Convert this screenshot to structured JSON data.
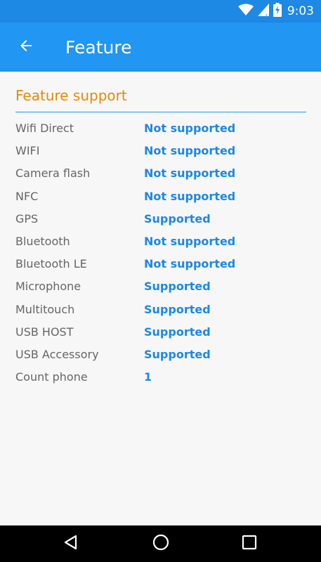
{
  "status_bar": {
    "time": "9:03",
    "icons": [
      "wifi-icon",
      "cellular-signal-icon",
      "battery-charging-icon"
    ]
  },
  "app_bar": {
    "title": "Feature",
    "back_icon": "arrow-back-icon"
  },
  "section": {
    "title": "Feature support"
  },
  "features": [
    {
      "label": "Wifi Direct",
      "value": "Not supported"
    },
    {
      "label": "WIFI",
      "value": "Not supported"
    },
    {
      "label": "Camera flash",
      "value": "Not supported"
    },
    {
      "label": "NFC",
      "value": "Not supported"
    },
    {
      "label": "GPS",
      "value": "Supported"
    },
    {
      "label": "Bluetooth",
      "value": "Not supported"
    },
    {
      "label": "Bluetooth LE",
      "value": "Not supported"
    },
    {
      "label": "Microphone",
      "value": "Supported"
    },
    {
      "label": "Multitouch",
      "value": "Supported"
    },
    {
      "label": "USB HOST",
      "value": "Supported"
    },
    {
      "label": "USB Accessory",
      "value": "Supported"
    },
    {
      "label": "Count phone",
      "value": "1"
    }
  ],
  "nav_bar": {
    "icons": [
      "back-triangle-icon",
      "home-circle-icon",
      "recents-square-icon"
    ]
  },
  "colors": {
    "status_bar": "#1e88e5",
    "app_bar": "#2196f3",
    "section_title": "#e68a00",
    "value_text": "#1e88e5",
    "label_text": "#666666",
    "background": "#f7f7f7"
  }
}
